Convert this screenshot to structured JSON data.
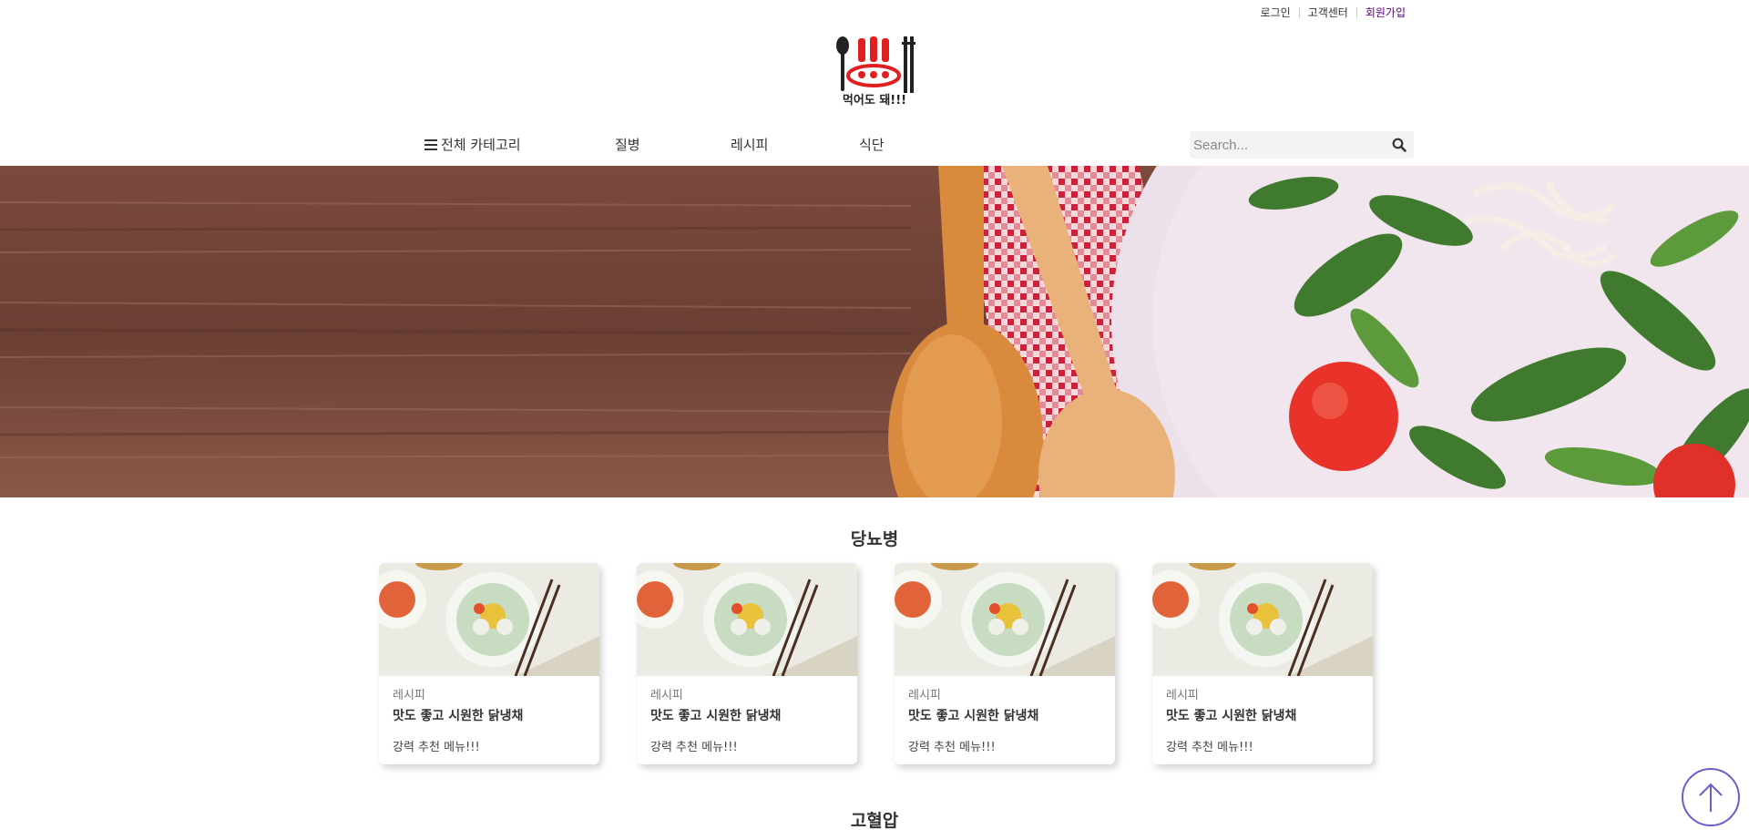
{
  "top_links": {
    "login": "로그인",
    "support": "고객센터",
    "signup": "회원가입"
  },
  "logo": {
    "text": "먹어도 돼!!!"
  },
  "nav": {
    "all_categories": "전체 카테고리",
    "disease": "질병",
    "recipe": "레시피",
    "diet": "식단",
    "search_placeholder": "Search..."
  },
  "sections": [
    {
      "title": "당뇨병",
      "cards": [
        {
          "category": "레시피",
          "title": "맛도 좋고 시원한 닭냉채",
          "desc": "강력 추천 메뉴!!!"
        },
        {
          "category": "레시피",
          "title": "맛도 좋고 시원한 닭냉채",
          "desc": "강력 추천 메뉴!!!"
        },
        {
          "category": "레시피",
          "title": "맛도 좋고 시원한 닭냉채",
          "desc": "강력 추천 메뉴!!!"
        },
        {
          "category": "레시피",
          "title": "맛도 좋고 시원한 닭냉채",
          "desc": "강력 추천 메뉴!!!"
        }
      ]
    },
    {
      "title": "고혈압"
    }
  ],
  "icons": {
    "menu": "hamburger-icon",
    "search": "search-icon",
    "scroll_top": "arrow-up-icon"
  },
  "colors": {
    "signup_accent": "#5f0080",
    "scroll_top_ring": "#6f5cc8",
    "logo_red": "#e02020"
  }
}
